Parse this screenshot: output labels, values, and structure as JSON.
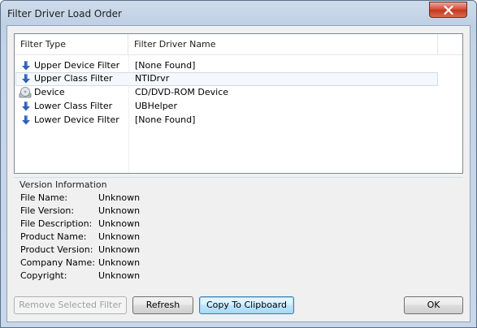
{
  "window": {
    "title": "Filter Driver Load Order"
  },
  "list": {
    "columns": [
      "Filter Type",
      "Filter Driver Name"
    ],
    "rows": [
      {
        "type": "Upper Device Filter",
        "name": "[None Found]",
        "icon": "down-arrow-icon"
      },
      {
        "type": "Upper Class Filter",
        "name": "NTIDrvr",
        "icon": "down-arrow-icon"
      },
      {
        "type": "Device",
        "name": "CD/DVD-ROM Device",
        "icon": "cd-drive-icon"
      },
      {
        "type": "Lower Class Filter",
        "name": "UBHelper",
        "icon": "down-arrow-icon"
      },
      {
        "type": "Lower Device Filter",
        "name": "[None Found]",
        "icon": "down-arrow-icon"
      }
    ]
  },
  "version_info": {
    "title": "Version Information",
    "fields": [
      {
        "label": "File Name:",
        "value": "Unknown"
      },
      {
        "label": "File Version:",
        "value": "Unknown"
      },
      {
        "label": "File Description:",
        "value": "Unknown"
      },
      {
        "label": "Product Name:",
        "value": "Unknown"
      },
      {
        "label": "Product Version:",
        "value": "Unknown"
      },
      {
        "label": "Company Name:",
        "value": "Unknown"
      },
      {
        "label": "Copyright:",
        "value": "Unknown"
      }
    ]
  },
  "buttons": {
    "remove": "Remove Selected Filter",
    "refresh": "Refresh",
    "copy": "Copy To Clipboard",
    "ok": "OK"
  },
  "colors": {
    "arrow": "#2f5fb3",
    "close": "#c4361f",
    "focus_border": "#3c7fb1"
  }
}
